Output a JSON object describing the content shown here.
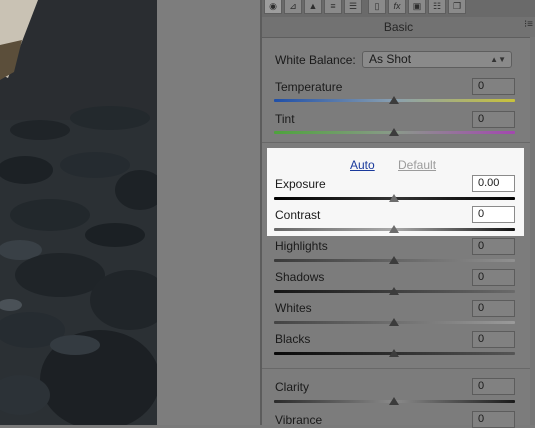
{
  "panel": {
    "title": "Basic",
    "menu_icon": "panel-menu-icon",
    "toolbar_icons": [
      "camera-icon",
      "tone-curve-icon",
      "detail-icon",
      "hsl-icon",
      "split-toning-icon",
      "lens-icon",
      "fx-icon",
      "camera-calibration-icon",
      "presets-icon",
      "snapshots-icon"
    ]
  },
  "white_balance": {
    "label": "White Balance:",
    "value": "As Shot"
  },
  "temperature": {
    "label": "Temperature",
    "value": "0",
    "level": 0.5
  },
  "tint": {
    "label": "Tint",
    "value": "0",
    "level": 0.5
  },
  "auto_default": {
    "auto": "Auto",
    "default": "Default"
  },
  "exposure": {
    "label": "Exposure",
    "value": "0.00",
    "level": 0.5
  },
  "contrast": {
    "label": "Contrast",
    "value": "0",
    "level": 0.5
  },
  "highlights": {
    "label": "Highlights",
    "value": "0",
    "level": 0.5
  },
  "shadows": {
    "label": "Shadows",
    "value": "0",
    "level": 0.5
  },
  "whites": {
    "label": "Whites",
    "value": "0",
    "level": 0.5
  },
  "blacks": {
    "label": "Blacks",
    "value": "0",
    "level": 0.5
  },
  "clarity": {
    "label": "Clarity",
    "value": "0",
    "level": 0.5
  },
  "vibrance": {
    "label": "Vibrance",
    "value": "0",
    "level": 0.5
  }
}
